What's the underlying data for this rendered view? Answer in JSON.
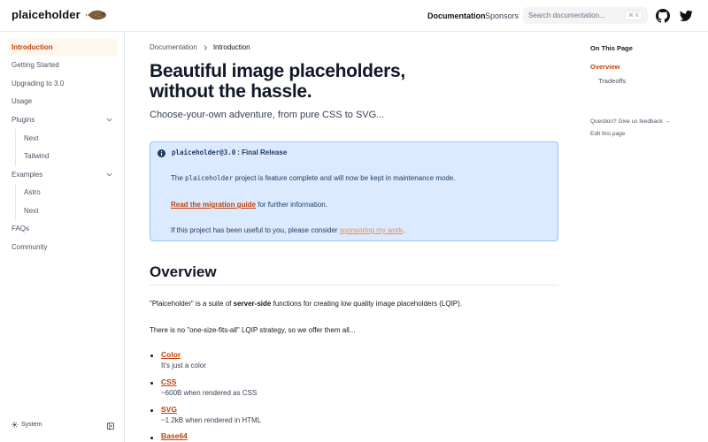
{
  "header": {
    "logo_text": "plaiceholder",
    "nav_docs": "Documentation",
    "nav_sponsors": "Sponsors",
    "search_placeholder": "Search documentation...",
    "search_shortcut": "⌘ K"
  },
  "sidebar": {
    "items": [
      {
        "label": "Introduction"
      },
      {
        "label": "Getting Started"
      },
      {
        "label": "Upgrading to 3.0"
      },
      {
        "label": "Usage"
      },
      {
        "label": "Plugins"
      },
      {
        "label": "Next"
      },
      {
        "label": "Tailwind"
      },
      {
        "label": "Examples"
      },
      {
        "label": "Astro"
      },
      {
        "label": "Next"
      },
      {
        "label": "FAQs"
      },
      {
        "label": "Community"
      }
    ],
    "theme_label": "System"
  },
  "breadcrumb": {
    "parent": "Documentation",
    "current": "Introduction"
  },
  "page": {
    "title_line1": "Beautiful image placeholders,",
    "title_line2": "without the hassle.",
    "lead": "Choose-your-own adventure, from pure CSS to SVG..."
  },
  "callout": {
    "title_code": "plaiceholder@3.0",
    "title_text": ": Final Release",
    "p1_pre": "The",
    "p1_code": "plaiceholder",
    "p1_post": "project is feature complete and will now be kept in maintenance mode.",
    "p2_link": "Read the migration guide",
    "p2_post": "for further information.",
    "p3_pre": "If this project has been useful to you, please consider",
    "p3_link": "sponsoring my work",
    "p3_post": "."
  },
  "overview": {
    "heading": "Overview",
    "p1_pre": "\"Plaiceholder\" is a suite of",
    "p1_bold": "server-side",
    "p1_post": "functions for creating low quality image placeholders (LQIP).",
    "p2": "There is no \"one-size-fits-all\" LQIP strategy, so we offer them all...",
    "list": [
      {
        "title": "Color",
        "desc": "It's just a color"
      },
      {
        "title": "CSS",
        "desc": "~600B when rendered as CSS"
      },
      {
        "title": "SVG",
        "desc": "~1.2kB when rendered in HTML"
      },
      {
        "title": "Base64",
        "desc": ""
      }
    ]
  },
  "toc": {
    "title": "On This Page",
    "items": [
      "Overview",
      "Tradeoffs"
    ],
    "feedback": "Question? Give us feedback →",
    "edit": "Edit this page"
  },
  "colors": {
    "accent": "#c2410c",
    "callout_bg": "#dbeafe",
    "callout_border": "#93c5fd",
    "active_bg": "#fff7ed"
  }
}
